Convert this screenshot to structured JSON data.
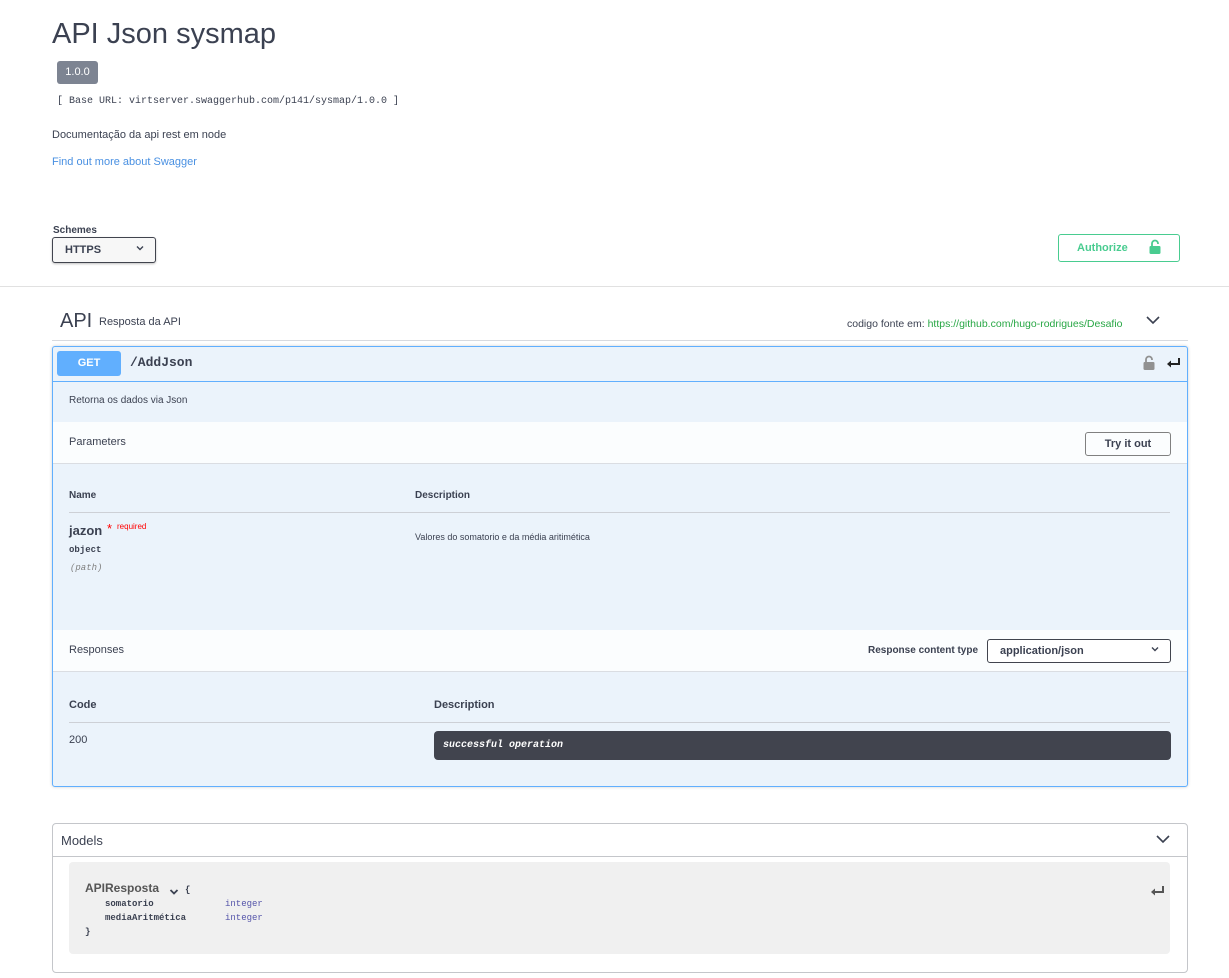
{
  "info": {
    "title": "API Json sysmap",
    "version": "1.0.0",
    "base_url": "[ Base URL: virtserver.swaggerhub.com/p141/sysmap/1.0.0 ]",
    "description": "Documentação da api rest em node",
    "external_link": "Find out more about Swagger"
  },
  "schemes": {
    "label": "Schemes",
    "selected": "HTTPS",
    "chevron_icon": "chevron-down-icon"
  },
  "authorize": {
    "label": "Authorize",
    "icon": "unlocked-lock-icon",
    "color": "#49cc90"
  },
  "tag": {
    "name": "API",
    "description": "Resposta da API",
    "external_docs_label": "codigo fonte em:",
    "external_docs_link": "https://github.com/hugo-rodrigues/Desafio",
    "link_color": "#28a745"
  },
  "operation": {
    "method": "GET",
    "method_color": "#61affe",
    "path": "/AddJson",
    "summary": "Retorna os dados via Json",
    "parameters_title": "Parameters",
    "try_it_out": "Try it out",
    "param_table": {
      "headers": [
        "Name",
        "Description"
      ],
      "rows": [
        {
          "name": "jazon",
          "required_star": "*",
          "required_label": "required",
          "type": "object",
          "in": "(path)",
          "description": "Valores do somatorio e da média aritimética"
        }
      ]
    },
    "responses_title": "Responses",
    "response_content_type_label": "Response content type",
    "response_content_type": "application/json",
    "response_table": {
      "headers": [
        "Code",
        "Description"
      ],
      "rows": [
        {
          "code": "200",
          "description": "successful operation"
        }
      ]
    }
  },
  "models": {
    "title": "Models",
    "items": [
      {
        "name": "APIResposta",
        "open_brace": "{",
        "close_brace": "}",
        "properties": [
          {
            "name": "somatorio",
            "type": "integer"
          },
          {
            "name": "mediaAritmética",
            "type": "integer"
          }
        ]
      }
    ]
  }
}
